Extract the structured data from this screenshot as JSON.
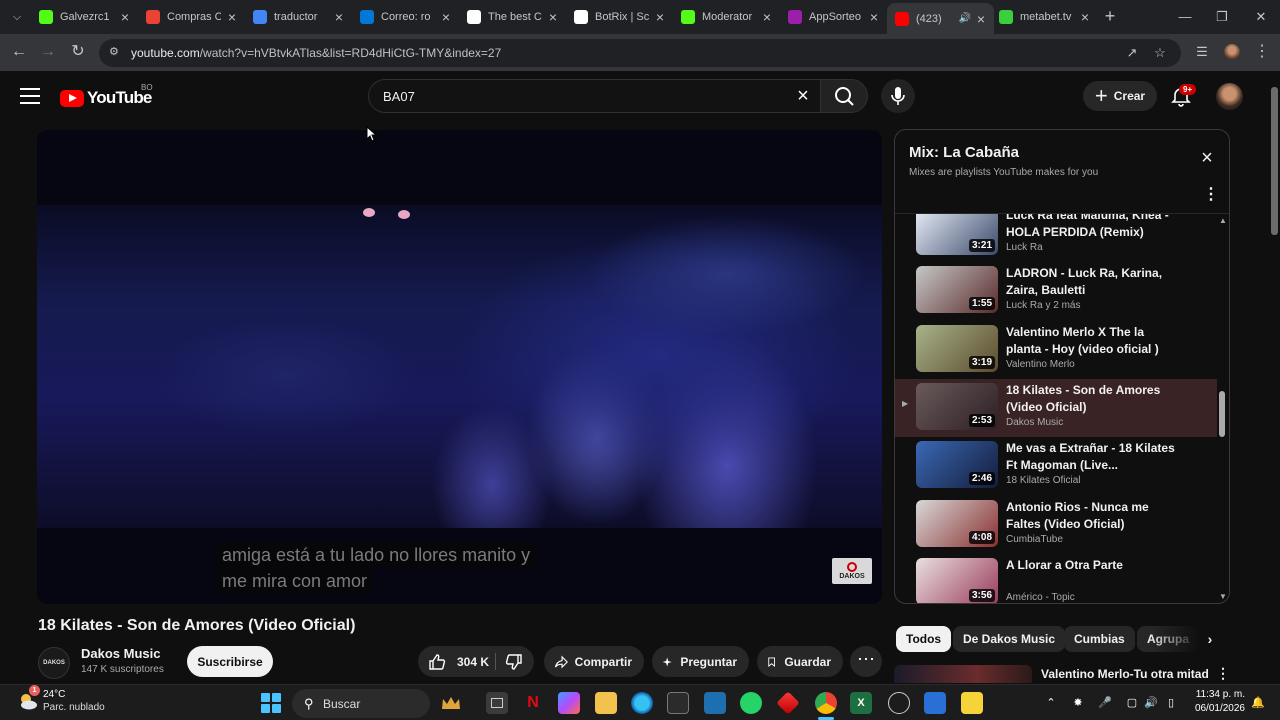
{
  "browser": {
    "tabs": [
      {
        "title": "Galvezrc1",
        "favicon": "kick-k",
        "color": "#53fc18",
        "active": false
      },
      {
        "title": "Compras C",
        "favicon": "gmail-icon",
        "color": "#ea4335",
        "active": false
      },
      {
        "title": "traductor",
        "favicon": "google-g",
        "color": "#4285f4",
        "active": false
      },
      {
        "title": "Correo: ro",
        "favicon": "outlook-icon",
        "color": "#0078d4",
        "active": false
      },
      {
        "title": "The best C",
        "favicon": "app-icon",
        "color": "#ffffff",
        "active": false
      },
      {
        "title": "BotRix | Sc",
        "favicon": "botrix-icon",
        "color": "#ffffff",
        "active": false
      },
      {
        "title": "Moderator",
        "favicon": "kick-k",
        "color": "#53fc18",
        "active": false
      },
      {
        "title": "AppSorteo",
        "favicon": "appsorteos-icon",
        "color": "#9b1fa8",
        "active": false
      },
      {
        "title": "(423)",
        "favicon": "youtube-icon",
        "color": "#ff0000",
        "active": true
      },
      {
        "title": "metabet.tv",
        "favicon": "metabet-icon",
        "color": "#3ccf3c",
        "active": false
      }
    ],
    "url_host": "youtube.com",
    "url_path": "/watch?v=hVBtvkATlas&list=RD4dHiCtG-TMY&index=27"
  },
  "header": {
    "logo_text": "YouTube",
    "country_code": "BO",
    "search_value": "BA07",
    "create_label": "Crear",
    "notification_count": "9+"
  },
  "player": {
    "subtitle_line1": "amiga está a tu lado no llores manito y",
    "subtitle_line2": "me mira con amor",
    "watermark_text": "DAKOS"
  },
  "video": {
    "title": "18 Kilates - Son de Amores (Video Oficial)",
    "channel_name": "Dakos Music",
    "channel_avatar_text": "DAKOS",
    "subscribers": "147 K suscriptores",
    "subscribe_label": "Suscribirse",
    "likes": "304 K",
    "share_label": "Compartir",
    "ask_label": "Preguntar",
    "save_label": "Guardar"
  },
  "playlist": {
    "title": "Mix: La Cabaña",
    "subtitle": "Mixes are playlists YouTube makes for you",
    "items": [
      {
        "title": "Luck Ra feat Maluma, Khea - HOLA PERDIDA (Remix)",
        "artist": "Luck Ra",
        "duration": "3:21",
        "current": false,
        "thumb_a": "#e9eef7",
        "thumb_b": "#3b4a6b"
      },
      {
        "title": "LADRON - Luck Ra, Karina, Zaira, Bauletti",
        "artist": "Luck Ra y 2 más",
        "duration": "1:55",
        "current": false,
        "thumb_a": "#c7c7c7",
        "thumb_b": "#5a2b2b"
      },
      {
        "title": "Valentino Merlo X The la planta - Hoy (video oficial )",
        "artist": "Valentino Merlo",
        "duration": "3:19",
        "current": false,
        "thumb_a": "#a7b38a",
        "thumb_b": "#5c4a2e"
      },
      {
        "title": "18 Kilates - Son de Amores (Video Oficial)",
        "artist": "Dakos Music",
        "duration": "2:53",
        "current": true,
        "thumb_a": "#6a5a5a",
        "thumb_b": "#2b1f24"
      },
      {
        "title": "Me vas a Extrañar - 18 Kilates Ft Magoman (Live...",
        "artist": "18 Kilates Oficial",
        "duration": "2:46",
        "current": false,
        "thumb_a": "#3a69b5",
        "thumb_b": "#141c3a"
      },
      {
        "title": "Antonio Rios - Nunca me Faltes (Video Oficial)",
        "artist": "CumbiaTube",
        "duration": "4:08",
        "current": false,
        "thumb_a": "#d8d8d8",
        "thumb_b": "#8a2f2f"
      },
      {
        "title": "A Llorar a Otra Parte",
        "artist": "Américo - Topic",
        "duration": "3:56",
        "current": false,
        "thumb_a": "#e9e0e0",
        "thumb_b": "#9a3a5a"
      }
    ]
  },
  "chips": [
    "Todos",
    "De Dakos Music",
    "Cumbias",
    "Agrupa"
  ],
  "next_recommendation": {
    "title": "Valentino Merlo-Tu otra mitad"
  },
  "taskbar": {
    "temperature": "24°C",
    "weather_desc": "Parc. nublado",
    "weather_badge": "1",
    "search_placeholder": "Buscar",
    "time": "11:34 p. m.",
    "date": "06/01/2026"
  }
}
